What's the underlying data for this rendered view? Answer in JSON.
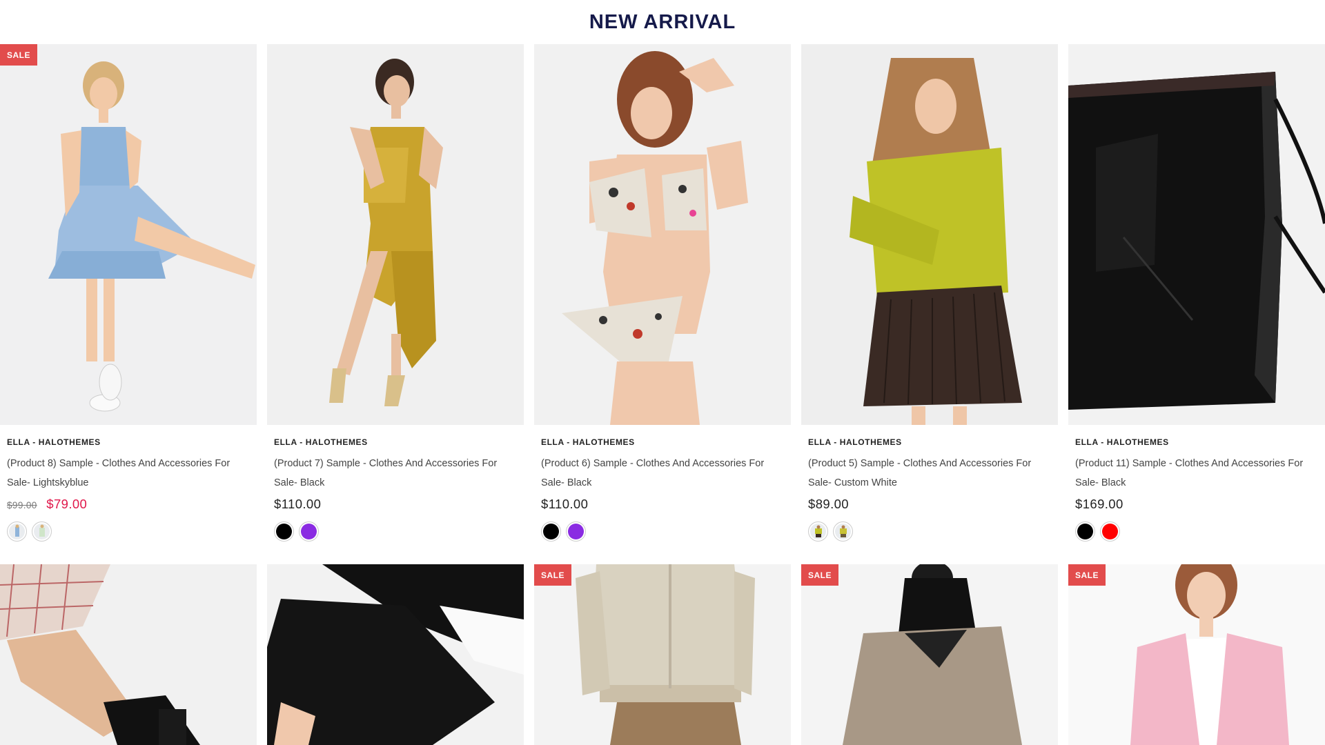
{
  "section": {
    "title": "NEW ARRIVAL"
  },
  "products_row1": [
    {
      "vendor": "ELLA - HALOTHEMES",
      "title": "(Product 8) Sample - Clothes And Accessories For Sale- Lightskyblue",
      "price_old": "$99.00",
      "price": "$79.00",
      "on_sale": true,
      "badge": "SALE",
      "swatches": [
        {
          "type": "image",
          "icon": "dress-blue-thumb"
        },
        {
          "type": "image",
          "icon": "dress-green-thumb"
        }
      ],
      "image_alt": "Woman in light blue denim tiered dress"
    },
    {
      "vendor": "ELLA - HALOTHEMES",
      "title": "(Product 7) Sample - Clothes And Accessories For Sale- Black",
      "price": "$110.00",
      "on_sale": false,
      "swatches": [
        {
          "type": "color",
          "color": "#000000"
        },
        {
          "type": "color",
          "color": "#8a2be2"
        }
      ],
      "image_alt": "Woman in mustard satin ruched dress"
    },
    {
      "vendor": "ELLA - HALOTHEMES",
      "title": "(Product 6) Sample - Clothes And Accessories For Sale- Black",
      "price": "$110.00",
      "on_sale": false,
      "swatches": [
        {
          "type": "color",
          "color": "#000000"
        },
        {
          "type": "color",
          "color": "#8a2be2"
        }
      ],
      "image_alt": "Woman in leopard print bikini"
    },
    {
      "vendor": "ELLA - HALOTHEMES",
      "title": "(Product 5) Sample - Clothes And Accessories For Sale- Custom White",
      "price": "$89.00",
      "on_sale": false,
      "swatches": [
        {
          "type": "image",
          "icon": "sweater-yellow-thumb"
        },
        {
          "type": "image",
          "icon": "sweater-yellow-thumb-2"
        }
      ],
      "image_alt": "Woman in chartreuse knit sweater and brown skirt"
    },
    {
      "vendor": "ELLA - HALOTHEMES",
      "title": "(Product 11) Sample - Clothes And Accessories For Sale- Black",
      "price": "$169.00",
      "on_sale": false,
      "swatches": [
        {
          "type": "color",
          "color": "#000000"
        },
        {
          "type": "color",
          "color": "#ff0000"
        }
      ],
      "image_alt": "Black patent leather tote bag"
    }
  ],
  "products_row2": [
    {
      "badge": "",
      "image_alt": "Legs in plaid skirt with black boots"
    },
    {
      "badge": "",
      "image_alt": "Black trousers close-up"
    },
    {
      "badge": "SALE",
      "image_alt": "Man in beige bomber jacket"
    },
    {
      "badge": "SALE",
      "image_alt": "Man in grey wool coat with black hoodie"
    },
    {
      "badge": "SALE",
      "image_alt": "Woman in pink blazer"
    }
  ],
  "colors": {
    "title": "#151a4a",
    "sale_badge": "#e24c4c",
    "sale_price": "#e0174a"
  }
}
